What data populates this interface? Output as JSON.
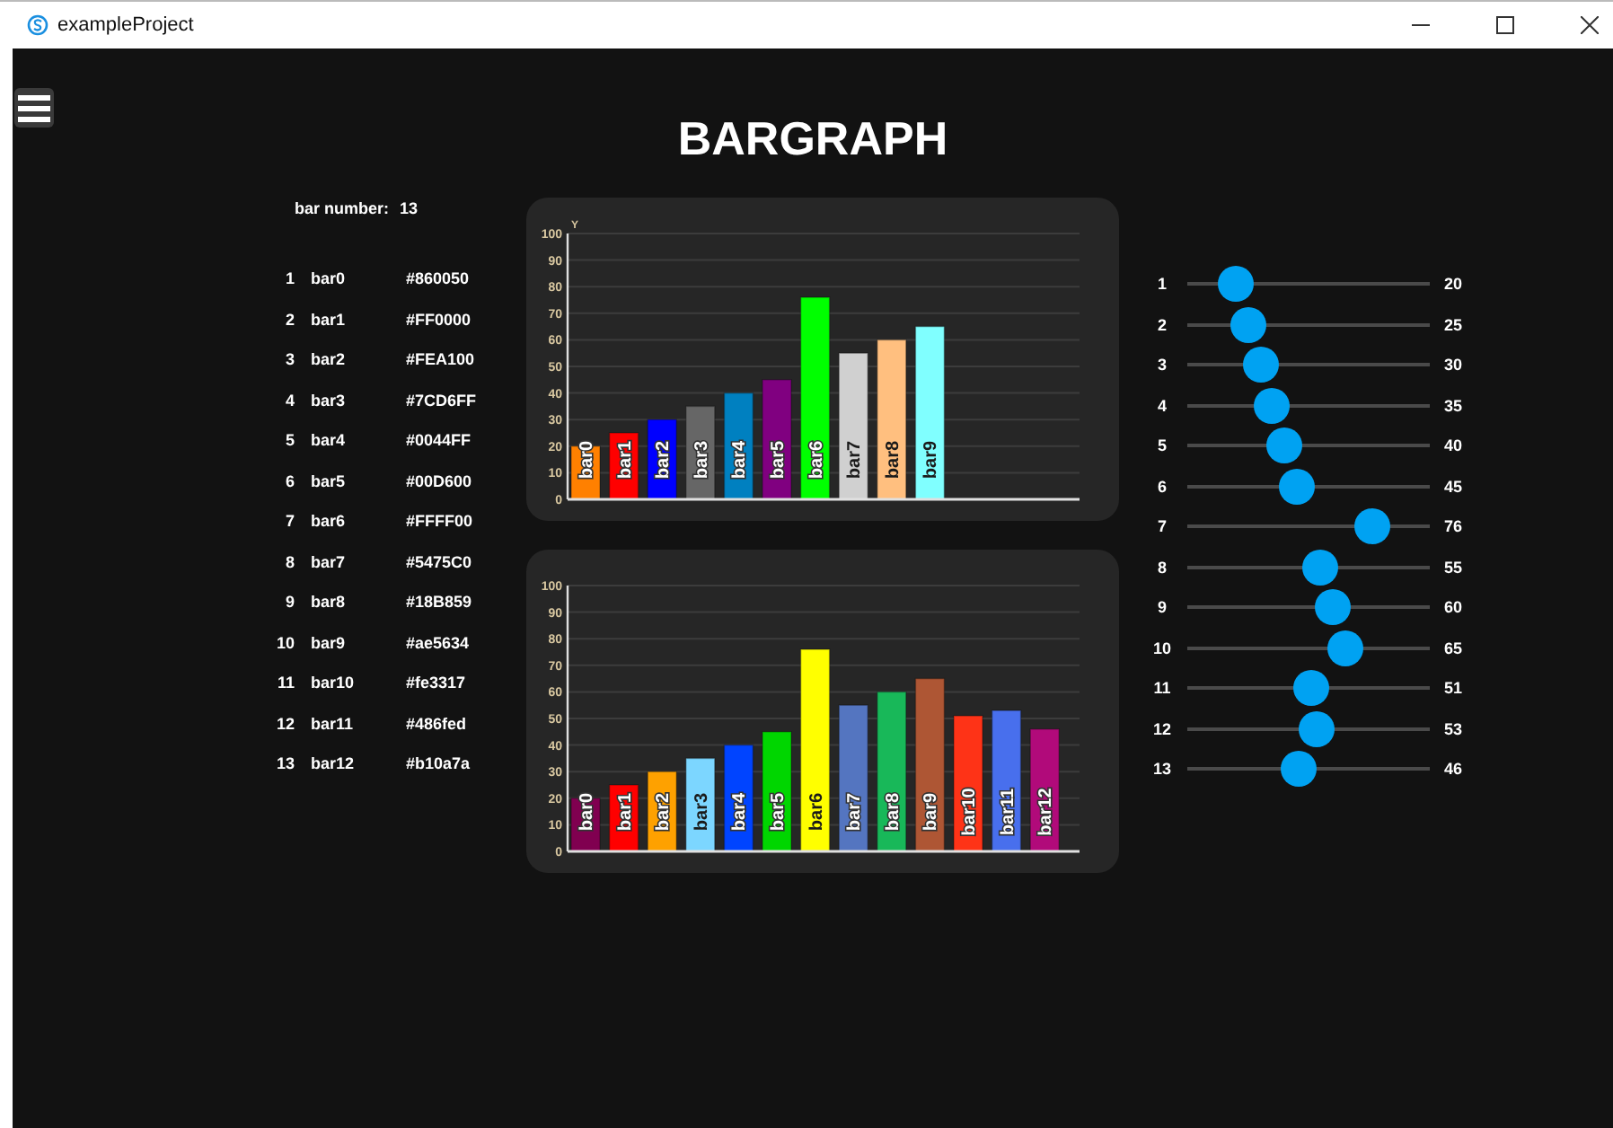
{
  "window": {
    "title": "exampleProject"
  },
  "page": {
    "title": "BARGRAPH"
  },
  "bar_number": {
    "label": "bar number:",
    "value": "13"
  },
  "bar_list": [
    {
      "index": "1",
      "name": "bar0",
      "hex": "#860050"
    },
    {
      "index": "2",
      "name": "bar1",
      "hex": "#FF0000"
    },
    {
      "index": "3",
      "name": "bar2",
      "hex": "#FEA100"
    },
    {
      "index": "4",
      "name": "bar3",
      "hex": "#7CD6FF"
    },
    {
      "index": "5",
      "name": "bar4",
      "hex": "#0044FF"
    },
    {
      "index": "6",
      "name": "bar5",
      "hex": "#00D600"
    },
    {
      "index": "7",
      "name": "bar6",
      "hex": "#FFFF00"
    },
    {
      "index": "8",
      "name": "bar7",
      "hex": "#5475C0"
    },
    {
      "index": "9",
      "name": "bar8",
      "hex": "#18B859"
    },
    {
      "index": "10",
      "name": "bar9",
      "hex": "#ae5634"
    },
    {
      "index": "11",
      "name": "bar10",
      "hex": "#fe3317"
    },
    {
      "index": "12",
      "name": "bar11",
      "hex": "#486fed"
    },
    {
      "index": "13",
      "name": "bar12",
      "hex": "#b10a7a"
    }
  ],
  "charts": [
    {
      "chart_data": {
        "type": "bar",
        "ylabel": "Y",
        "categories": [
          "bar0",
          "bar1",
          "bar2",
          "bar3",
          "bar4",
          "bar5",
          "bar6",
          "bar7",
          "bar8",
          "bar9"
        ],
        "values": [
          20,
          25,
          30,
          35,
          40,
          45,
          76,
          55,
          60,
          65
        ],
        "colors": [
          "#ff8000",
          "#ff0000",
          "#0000ff",
          "#666666",
          "#0080c0",
          "#800080",
          "#00ff00",
          "#d0d0d0",
          "#ffbf7f",
          "#80ffff"
        ],
        "ylim": [
          0,
          100
        ],
        "yticks": [
          0,
          10,
          20,
          30,
          40,
          50,
          60,
          70,
          80,
          90,
          100
        ],
        "grid": true
      }
    },
    {
      "chart_data": {
        "type": "bar",
        "categories": [
          "bar0",
          "bar1",
          "bar2",
          "bar3",
          "bar4",
          "bar5",
          "bar6",
          "bar7",
          "bar8",
          "bar9",
          "bar10",
          "bar11",
          "bar12"
        ],
        "values": [
          20,
          25,
          30,
          35,
          40,
          45,
          76,
          55,
          60,
          65,
          51,
          53,
          46
        ],
        "colors": [
          "#800050",
          "#ff0000",
          "#fea100",
          "#7cd6ff",
          "#0044ff",
          "#00d600",
          "#ffff00",
          "#5475c0",
          "#18b859",
          "#ae5634",
          "#fe3317",
          "#486fed",
          "#b10a7a"
        ],
        "ylim": [
          0,
          100
        ],
        "yticks": [
          0,
          10,
          20,
          30,
          40,
          50,
          60,
          70,
          80,
          90,
          100
        ],
        "grid": true
      }
    }
  ],
  "sliders": [
    {
      "label": "1",
      "level": 0.2,
      "reading": "20"
    },
    {
      "label": "2",
      "level": 0.25,
      "reading": "25"
    },
    {
      "label": "3",
      "level": 0.3,
      "reading": "30"
    },
    {
      "label": "4",
      "level": 0.35,
      "reading": "35"
    },
    {
      "label": "5",
      "level": 0.4,
      "reading": "40"
    },
    {
      "label": "6",
      "level": 0.45,
      "reading": "45"
    },
    {
      "label": "7",
      "level": 0.76,
      "reading": "76"
    },
    {
      "label": "8",
      "level": 0.55,
      "reading": "55"
    },
    {
      "label": "9",
      "level": 0.6,
      "reading": "60"
    },
    {
      "label": "10",
      "level": 0.65,
      "reading": "65"
    },
    {
      "label": "11",
      "level": 0.51,
      "reading": "51"
    },
    {
      "label": "12",
      "level": 0.53,
      "reading": "53"
    },
    {
      "label": "13",
      "level": 0.46,
      "reading": "46"
    }
  ]
}
